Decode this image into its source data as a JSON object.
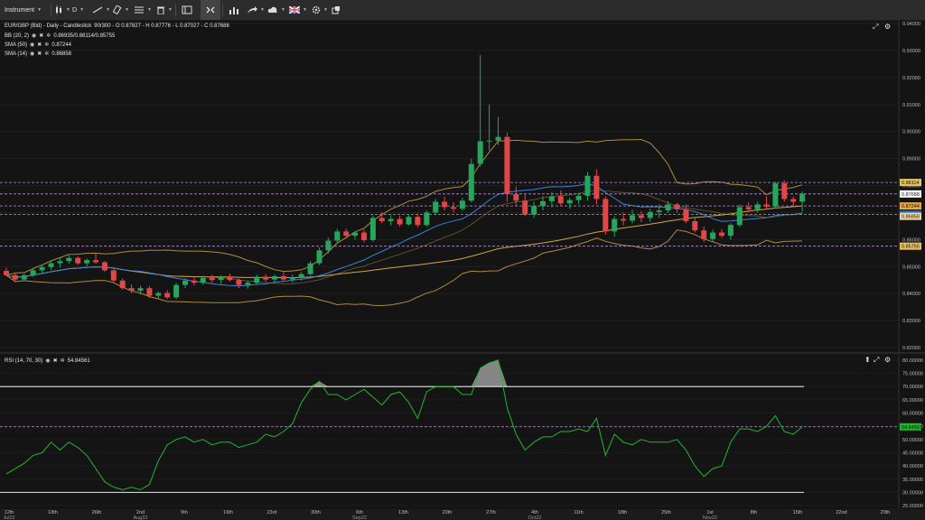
{
  "toolbar": {
    "instrument": "Instrument",
    "timeframe": "D"
  },
  "price_pane": {
    "legend": [
      {
        "label": "EUR/GBP (Bid) - Daily - Candlestick",
        "value": "90/300 - O 0.87827 - H 0.87776 - L 0.87027 - C 0.87688"
      },
      {
        "label": "BB (20, 2)",
        "value": "0.86935/0.88114/0.85755"
      },
      {
        "label": "SMA (50)",
        "value": "0.87244"
      },
      {
        "label": "SMA (14)",
        "value": "0.86858"
      }
    ],
    "y_labels": [
      "0.94000",
      "0.93000",
      "0.92000",
      "0.91000",
      "0.90000",
      "0.89000",
      "0.88000",
      "0.87000",
      "0.86000",
      "0.85000",
      "0.84000",
      "0.83000",
      "0.82000"
    ],
    "price_tags": [
      {
        "text": "0.88114",
        "bg": "#e8c15a",
        "fg": "#111111"
      },
      {
        "text": "0.87688",
        "bg": "#ffffff",
        "fg": "#111111"
      },
      {
        "text": "0.87244",
        "bg": "#e8a640",
        "fg": "#111111"
      },
      {
        "text": "0.86935",
        "bg": "#1d6fd6",
        "fg": "#ffffff"
      },
      {
        "text": "0.86858",
        "bg": "#e9d6a0",
        "fg": "#111111"
      },
      {
        "text": "0.85755",
        "bg": "#e8c15a",
        "fg": "#111111"
      }
    ]
  },
  "rsi_pane": {
    "legend_label": "RSI (14, 70, 30)",
    "legend_value": "54.84561",
    "y_labels": [
      "80.00000",
      "75.00000",
      "70.00000",
      "65.00000",
      "60.00000",
      "55.00000",
      "50.00000",
      "45.00000",
      "40.00000",
      "35.00000",
      "30.00000",
      "25.00000"
    ],
    "value_tag": "54.84561",
    "overbought": 70,
    "oversold": 30
  },
  "x_axis": [
    {
      "label": "12th",
      "sub": "Jul22"
    },
    {
      "label": "18th",
      "sub": ""
    },
    {
      "label": "26th",
      "sub": ""
    },
    {
      "label": "2nd",
      "sub": "Aug22"
    },
    {
      "label": "9th",
      "sub": ""
    },
    {
      "label": "16th",
      "sub": ""
    },
    {
      "label": "23rd",
      "sub": ""
    },
    {
      "label": "30th",
      "sub": ""
    },
    {
      "label": "6th",
      "sub": "Sep22"
    },
    {
      "label": "13th",
      "sub": ""
    },
    {
      "label": "20th",
      "sub": ""
    },
    {
      "label": "27th",
      "sub": ""
    },
    {
      "label": "4th",
      "sub": "Oct22"
    },
    {
      "label": "11th",
      "sub": ""
    },
    {
      "label": "18th",
      "sub": ""
    },
    {
      "label": "25th",
      "sub": ""
    },
    {
      "label": "1st",
      "sub": "Nov22"
    },
    {
      "label": "8th",
      "sub": ""
    },
    {
      "label": "15th",
      "sub": ""
    },
    {
      "label": "22nd",
      "sub": ""
    },
    {
      "label": "29th",
      "sub": ""
    }
  ],
  "colors": {
    "up": "#26a65b",
    "down": "#e04848",
    "bb": "#b08a3c",
    "sma50": "#d4a447",
    "sma14": "#3a82d8",
    "rsi": "#1fb82a"
  },
  "chart_data": {
    "type": "candlestick",
    "candles": [
      [
        0.8484,
        0.8496,
        0.8464,
        0.8468
      ],
      [
        0.8468,
        0.8474,
        0.8444,
        0.8452
      ],
      [
        0.8452,
        0.8474,
        0.8448,
        0.8468
      ],
      [
        0.8468,
        0.8492,
        0.8462,
        0.8486
      ],
      [
        0.8486,
        0.8506,
        0.8476,
        0.8498
      ],
      [
        0.8498,
        0.8522,
        0.8488,
        0.8512
      ],
      [
        0.8512,
        0.8532,
        0.8496,
        0.852
      ],
      [
        0.852,
        0.8542,
        0.851,
        0.8532
      ],
      [
        0.8532,
        0.8538,
        0.8506,
        0.8512
      ],
      [
        0.8512,
        0.853,
        0.8502,
        0.8524
      ],
      [
        0.8524,
        0.855,
        0.851,
        0.8516
      ],
      [
        0.8516,
        0.852,
        0.848,
        0.8486
      ],
      [
        0.8486,
        0.8498,
        0.844,
        0.8448
      ],
      [
        0.8448,
        0.8456,
        0.8414,
        0.842
      ],
      [
        0.842,
        0.8434,
        0.8402,
        0.841
      ],
      [
        0.841,
        0.843,
        0.8396,
        0.842
      ],
      [
        0.842,
        0.8428,
        0.8384,
        0.8392
      ],
      [
        0.8392,
        0.8408,
        0.8382,
        0.8402
      ],
      [
        0.8402,
        0.8412,
        0.838,
        0.8386
      ],
      [
        0.8386,
        0.844,
        0.838,
        0.8432
      ],
      [
        0.8432,
        0.8456,
        0.842,
        0.8448
      ],
      [
        0.8448,
        0.8462,
        0.843,
        0.844
      ],
      [
        0.844,
        0.8466,
        0.8432,
        0.8458
      ],
      [
        0.8458,
        0.847,
        0.844,
        0.845
      ],
      [
        0.845,
        0.8468,
        0.8436,
        0.8462
      ],
      [
        0.8462,
        0.8474,
        0.8444,
        0.845
      ],
      [
        0.845,
        0.8456,
        0.842,
        0.8432
      ],
      [
        0.8432,
        0.8448,
        0.8418,
        0.844
      ],
      [
        0.844,
        0.847,
        0.8434,
        0.8462
      ],
      [
        0.8462,
        0.8472,
        0.8444,
        0.8452
      ],
      [
        0.8452,
        0.847,
        0.8442,
        0.8464
      ],
      [
        0.8464,
        0.848,
        0.8446,
        0.8452
      ],
      [
        0.8452,
        0.847,
        0.844,
        0.846
      ],
      [
        0.846,
        0.848,
        0.8448,
        0.8472
      ],
      [
        0.8472,
        0.852,
        0.8466,
        0.8512
      ],
      [
        0.8512,
        0.857,
        0.8506,
        0.856
      ],
      [
        0.856,
        0.8606,
        0.8548,
        0.8596
      ],
      [
        0.8596,
        0.864,
        0.8588,
        0.863
      ],
      [
        0.863,
        0.864,
        0.8604,
        0.8614
      ],
      [
        0.8614,
        0.863,
        0.86,
        0.8626
      ],
      [
        0.8626,
        0.8636,
        0.859,
        0.8598
      ],
      [
        0.8598,
        0.869,
        0.8592,
        0.868
      ],
      [
        0.868,
        0.8702,
        0.866,
        0.8668
      ],
      [
        0.8668,
        0.869,
        0.8652,
        0.8676
      ],
      [
        0.8676,
        0.8688,
        0.8648,
        0.8656
      ],
      [
        0.8656,
        0.869,
        0.8652,
        0.8684
      ],
      [
        0.8684,
        0.8696,
        0.8646,
        0.8654
      ],
      [
        0.8654,
        0.8708,
        0.8648,
        0.87
      ],
      [
        0.87,
        0.875,
        0.869,
        0.874
      ],
      [
        0.874,
        0.8758,
        0.8708,
        0.872
      ],
      [
        0.872,
        0.8738,
        0.87,
        0.8714
      ],
      [
        0.8714,
        0.8754,
        0.8706,
        0.8744
      ],
      [
        0.8744,
        0.89,
        0.8738,
        0.888
      ],
      [
        0.888,
        0.9284,
        0.887,
        0.8964
      ],
      [
        0.8964,
        0.91,
        0.893,
        0.8966
      ],
      [
        0.8966,
        0.9054,
        0.895,
        0.898
      ],
      [
        0.898,
        0.8996,
        0.874,
        0.8768
      ],
      [
        0.8768,
        0.8796,
        0.8724,
        0.8744
      ],
      [
        0.8744,
        0.8766,
        0.8686,
        0.8692
      ],
      [
        0.8692,
        0.874,
        0.868,
        0.8724
      ],
      [
        0.8724,
        0.876,
        0.8708,
        0.8742
      ],
      [
        0.8742,
        0.8776,
        0.872,
        0.876
      ],
      [
        0.876,
        0.8782,
        0.8724,
        0.8734
      ],
      [
        0.8734,
        0.8754,
        0.8714,
        0.8746
      ],
      [
        0.8746,
        0.877,
        0.873,
        0.8762
      ],
      [
        0.8762,
        0.885,
        0.8744,
        0.8836
      ],
      [
        0.8836,
        0.886,
        0.873,
        0.875
      ],
      [
        0.875,
        0.876,
        0.8618,
        0.863
      ],
      [
        0.863,
        0.8686,
        0.861,
        0.8676
      ],
      [
        0.8676,
        0.87,
        0.8652,
        0.867
      ],
      [
        0.867,
        0.871,
        0.866,
        0.869
      ],
      [
        0.869,
        0.8706,
        0.8664,
        0.868
      ],
      [
        0.868,
        0.8714,
        0.8666,
        0.8702
      ],
      [
        0.8702,
        0.873,
        0.868,
        0.8708
      ],
      [
        0.8708,
        0.8742,
        0.8698,
        0.873
      ],
      [
        0.873,
        0.8736,
        0.87,
        0.8712
      ],
      [
        0.8712,
        0.873,
        0.866,
        0.8668
      ],
      [
        0.8668,
        0.868,
        0.8626,
        0.8634
      ],
      [
        0.8634,
        0.8648,
        0.859,
        0.8602
      ],
      [
        0.8602,
        0.8636,
        0.859,
        0.8626
      ],
      [
        0.8626,
        0.8638,
        0.8606,
        0.8614
      ],
      [
        0.8614,
        0.866,
        0.86,
        0.8654
      ],
      [
        0.8654,
        0.873,
        0.8646,
        0.872
      ],
      [
        0.872,
        0.8738,
        0.87,
        0.8712
      ],
      [
        0.8712,
        0.874,
        0.87,
        0.873
      ],
      [
        0.873,
        0.876,
        0.871,
        0.8722
      ],
      [
        0.8722,
        0.8814,
        0.8716,
        0.8808
      ],
      [
        0.8808,
        0.882,
        0.874,
        0.875
      ],
      [
        0.875,
        0.876,
        0.8722,
        0.874
      ],
      [
        0.874,
        0.8778,
        0.8703,
        0.8769
      ]
    ],
    "rsi": [
      37,
      39,
      41,
      44,
      45,
      49,
      46,
      49,
      47,
      44,
      39,
      34,
      32,
      31,
      32,
      31,
      33,
      42,
      48,
      50,
      51,
      49,
      50,
      48,
      49,
      49,
      47,
      48,
      49,
      52,
      51,
      53,
      56,
      64,
      69,
      72,
      67,
      67,
      65,
      67,
      69,
      66,
      63,
      67,
      68,
      64,
      58,
      68,
      70,
      70,
      70,
      67,
      67,
      77,
      79,
      80,
      62,
      52,
      46,
      49,
      51,
      51,
      53,
      53,
      54,
      53,
      58,
      44,
      52,
      49,
      48,
      50,
      49,
      49,
      49,
      50,
      46,
      40,
      36,
      39,
      40,
      49,
      54,
      54,
      53,
      55,
      59,
      53,
      52,
      54.8
    ]
  }
}
